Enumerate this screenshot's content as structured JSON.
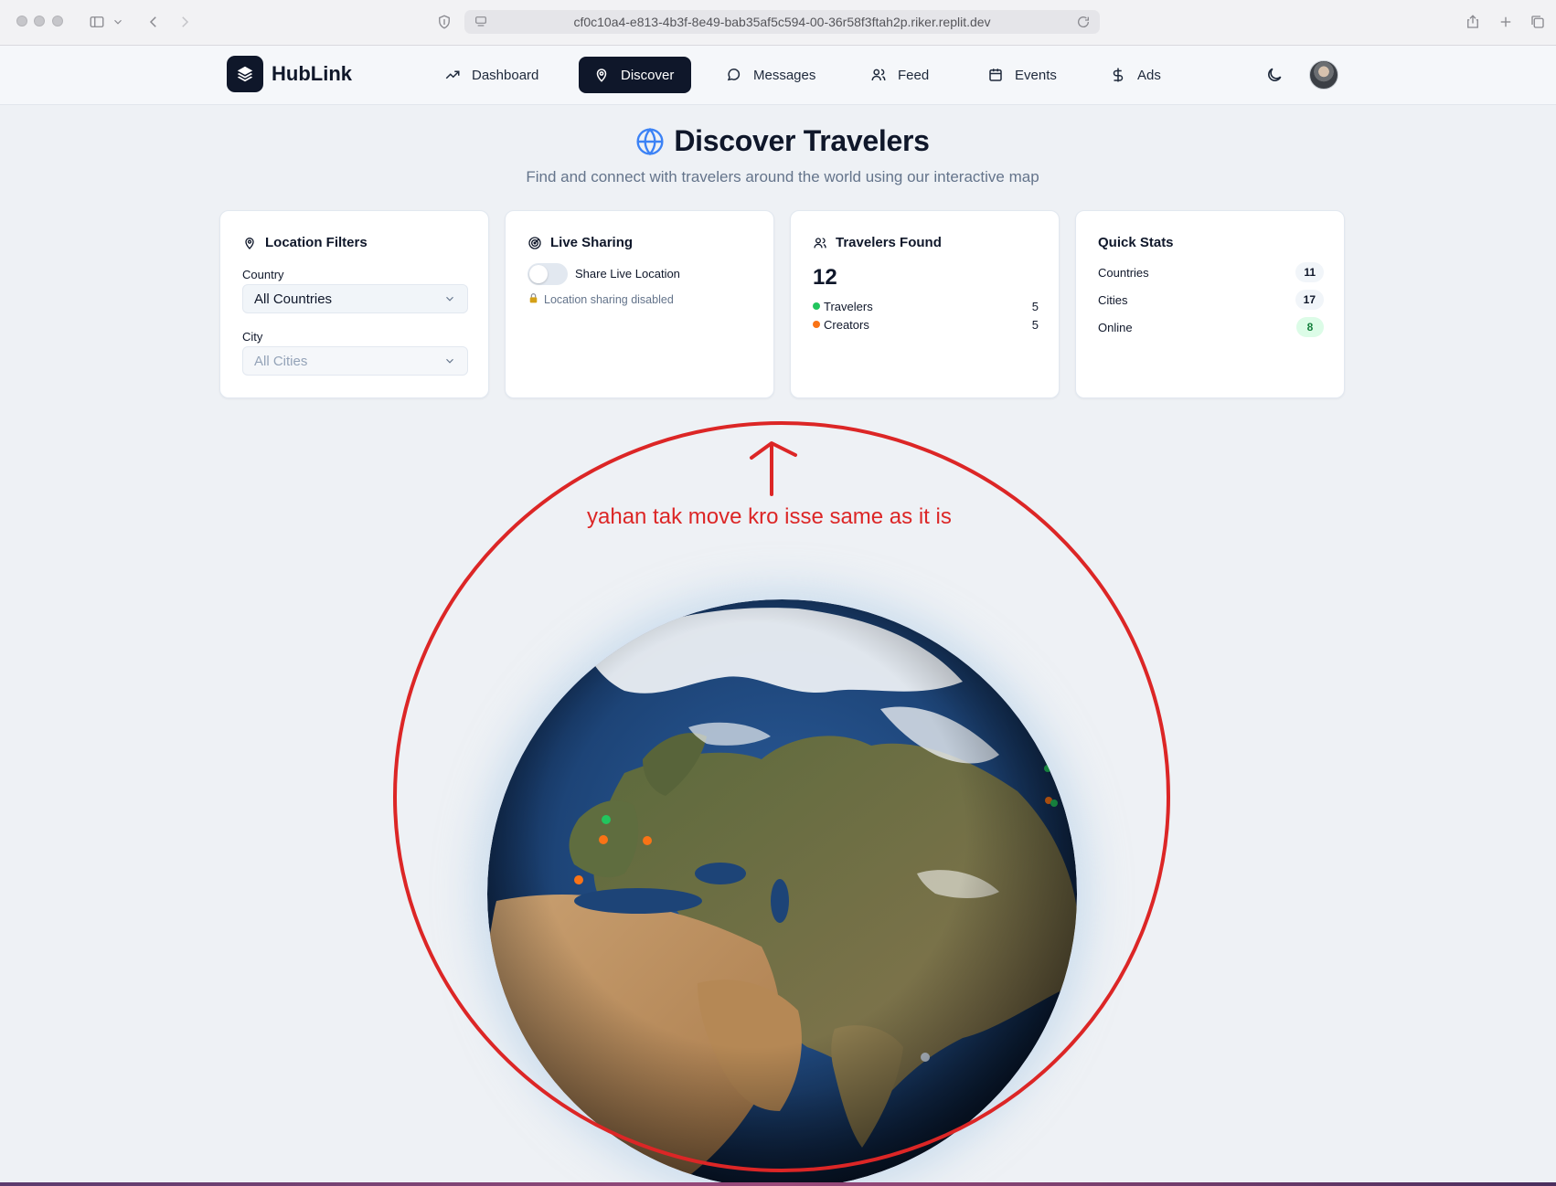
{
  "browser": {
    "url": "cf0c10a4-e813-4b3f-8e49-bab35af5c594-00-36r58f3ftah2p.riker.replit.dev",
    "icons": [
      "sidebar-icon",
      "chevron-down-icon",
      "back-icon",
      "forward-icon",
      "shield-icon",
      "site-settings-icon",
      "reload-icon",
      "share-icon",
      "new-tab-icon",
      "tab-overview-icon"
    ]
  },
  "nav": {
    "brand": "HubLink",
    "items": [
      {
        "label": "Dashboard",
        "icon": "trending-up-icon",
        "active": false
      },
      {
        "label": "Discover",
        "icon": "map-pin-icon",
        "active": true
      },
      {
        "label": "Messages",
        "icon": "message-icon",
        "active": false
      },
      {
        "label": "Feed",
        "icon": "users-icon",
        "active": false
      },
      {
        "label": "Events",
        "icon": "calendar-icon",
        "active": false
      },
      {
        "label": "Ads",
        "icon": "dollar-icon",
        "active": false
      }
    ],
    "theme_icon": "moon-icon"
  },
  "header": {
    "title": "Discover Travelers",
    "subtitle": "Find and connect with travelers around the world using our interactive map"
  },
  "filters": {
    "title": "Location Filters",
    "country_label": "Country",
    "country_value": "All Countries",
    "city_label": "City",
    "city_value": "All Cities"
  },
  "live_sharing": {
    "title": "Live Sharing",
    "toggle_label": "Share Live Location",
    "toggle_on": false,
    "status": "Location sharing disabled",
    "status_icon": "lock-icon"
  },
  "travelers_found": {
    "title": "Travelers Found",
    "count": "12",
    "legend": [
      {
        "label": "Travelers",
        "value": "5",
        "color": "#22c55e"
      },
      {
        "label": "Creators",
        "value": "5",
        "color": "#f97316"
      }
    ]
  },
  "quick_stats": {
    "title": "Quick Stats",
    "rows": [
      {
        "label": "Countries",
        "value": "11"
      },
      {
        "label": "Cities",
        "value": "17"
      },
      {
        "label": "Online",
        "value": "8"
      }
    ]
  },
  "annotation": {
    "text": "yahan tak move kro isse same as it is",
    "color": "#dc2626"
  },
  "colors": {
    "primary": "#0f172a",
    "accent": "#3b82f6",
    "traveler": "#22c55e",
    "creator": "#f97316",
    "annotation": "#dc2626"
  }
}
